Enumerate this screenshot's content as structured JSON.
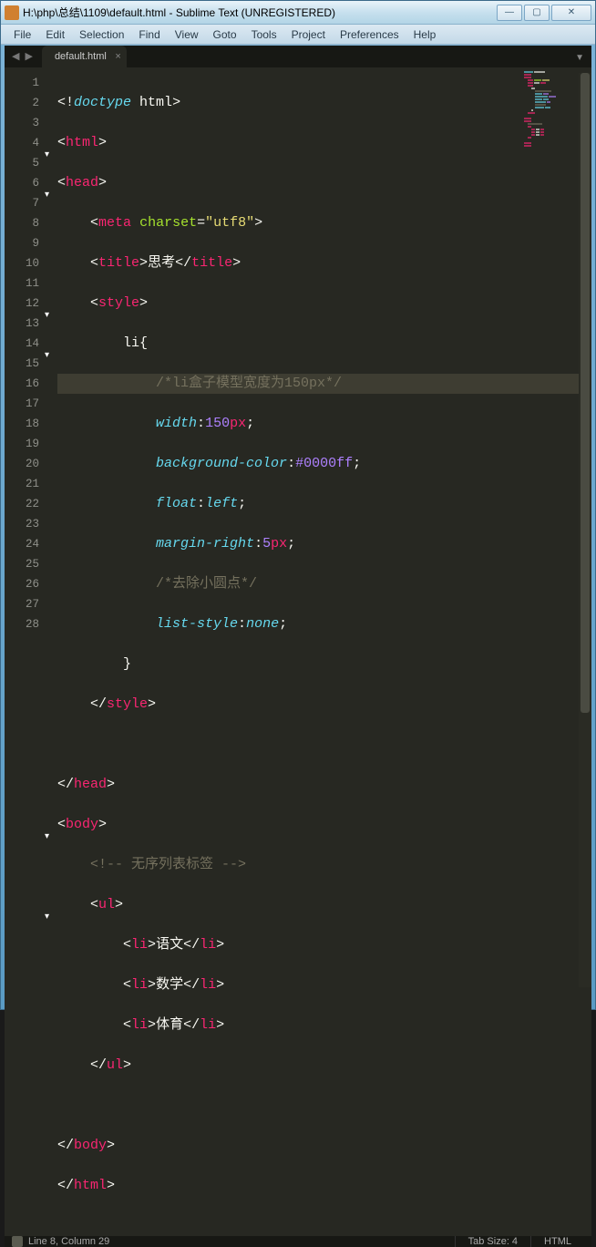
{
  "window": {
    "title": "H:\\php\\总结\\1109\\default.html - Sublime Text (UNREGISTERED)"
  },
  "menu": {
    "items": [
      "File",
      "Edit",
      "Selection",
      "Find",
      "View",
      "Goto",
      "Tools",
      "Project",
      "Preferences",
      "Help"
    ]
  },
  "tabs": {
    "active": "default.html"
  },
  "gutter": {
    "total_lines": 28
  },
  "active_line": 8,
  "code": {
    "l1": {
      "ang_o": "<!",
      "doctype": "doctype",
      "sp": " ",
      "html": "html",
      "ang_c": ">"
    },
    "l2": {
      "ang_o": "<",
      "tag": "html",
      "ang_c": ">"
    },
    "l3": {
      "ang_o": "<",
      "tag": "head",
      "ang_c": ">"
    },
    "l4": {
      "ang_o": "<",
      "tag": "meta",
      "sp": " ",
      "attr": "charset",
      "eq": "=",
      "q": "\"",
      "val": "utf8",
      "q2": "\"",
      "ang_c": ">"
    },
    "l5": {
      "ang_o": "<",
      "tag": "title",
      "ang_c": ">",
      "txt": "思考",
      "ang_o2": "</",
      "tag2": "title",
      "ang_c2": ">"
    },
    "l6": {
      "ang_o": "<",
      "tag": "style",
      "ang_c": ">"
    },
    "l7": {
      "sel": "li",
      "brace": "{"
    },
    "l8": {
      "cmt": "/*li盒子模型宽度为150px*/"
    },
    "l9": {
      "prop": "width",
      "colon": ":",
      "num": "150",
      "unit": "px",
      "semi": ";"
    },
    "l10": {
      "prop": "background-color",
      "colon": ":",
      "val": "#0000ff",
      "semi": ";"
    },
    "l11": {
      "prop": "float",
      "colon": ":",
      "val": "left",
      "semi": ";"
    },
    "l12": {
      "prop": "margin-right",
      "colon": ":",
      "num": "5",
      "unit": "px",
      "semi": ";"
    },
    "l13": {
      "cmt": "/*去除小圆点*/"
    },
    "l14": {
      "prop": "list-style",
      "colon": ":",
      "val": "none",
      "semi": ";"
    },
    "l15": {
      "brace": "}"
    },
    "l16": {
      "ang_o": "</",
      "tag": "style",
      "ang_c": ">"
    },
    "l18": {
      "ang_o": "</",
      "tag": "head",
      "ang_c": ">"
    },
    "l19": {
      "ang_o": "<",
      "tag": "body",
      "ang_c": ">"
    },
    "l20": {
      "cmt_o": "<!-- ",
      "cmt": "无序列表标签",
      "cmt_c": " -->"
    },
    "l21": {
      "ang_o": "<",
      "tag": "ul",
      "ang_c": ">"
    },
    "l22": {
      "ang_o": "<",
      "tag": "li",
      "ang_c": ">",
      "txt": "语文",
      "ang_o2": "</",
      "tag2": "li",
      "ang_c2": ">"
    },
    "l23": {
      "ang_o": "<",
      "tag": "li",
      "ang_c": ">",
      "txt": "数学",
      "ang_o2": "</",
      "tag2": "li",
      "ang_c2": ">"
    },
    "l24": {
      "ang_o": "<",
      "tag": "li",
      "ang_c": ">",
      "txt": "体育",
      "ang_o2": "</",
      "tag2": "li",
      "ang_c2": ">"
    },
    "l25": {
      "ang_o": "</",
      "tag": "ul",
      "ang_c": ">"
    },
    "l27": {
      "ang_o": "</",
      "tag": "body",
      "ang_c": ">"
    },
    "l28": {
      "ang_o": "</",
      "tag": "html",
      "ang_c": ">"
    }
  },
  "status": {
    "position": "Line 8, Column 29",
    "tabsize": "Tab Size: 4",
    "syntax": "HTML"
  }
}
